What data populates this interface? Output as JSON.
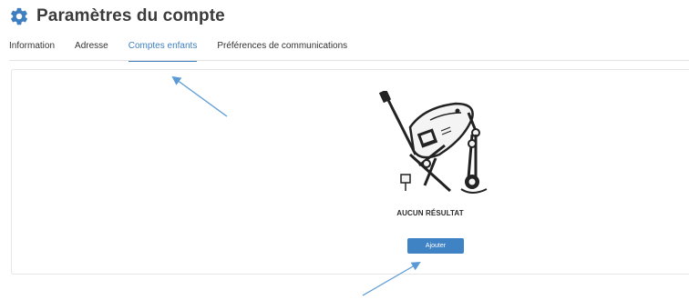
{
  "header": {
    "title": "Paramètres du compte",
    "icon": "gear-icon"
  },
  "tabs": [
    {
      "label": "Information",
      "active": false
    },
    {
      "label": "Adresse",
      "active": false
    },
    {
      "label": "Comptes enfants",
      "active": true
    },
    {
      "label": "Préférences de communications",
      "active": false
    }
  ],
  "empty_state": {
    "message": "AUCUN RÉSULTAT",
    "add_label": "Ajouter",
    "illustration": "robot-illustration"
  },
  "colors": {
    "accent": "#3f7fc0",
    "button": "#3f83c4",
    "annotation": "#5b9bd5"
  }
}
